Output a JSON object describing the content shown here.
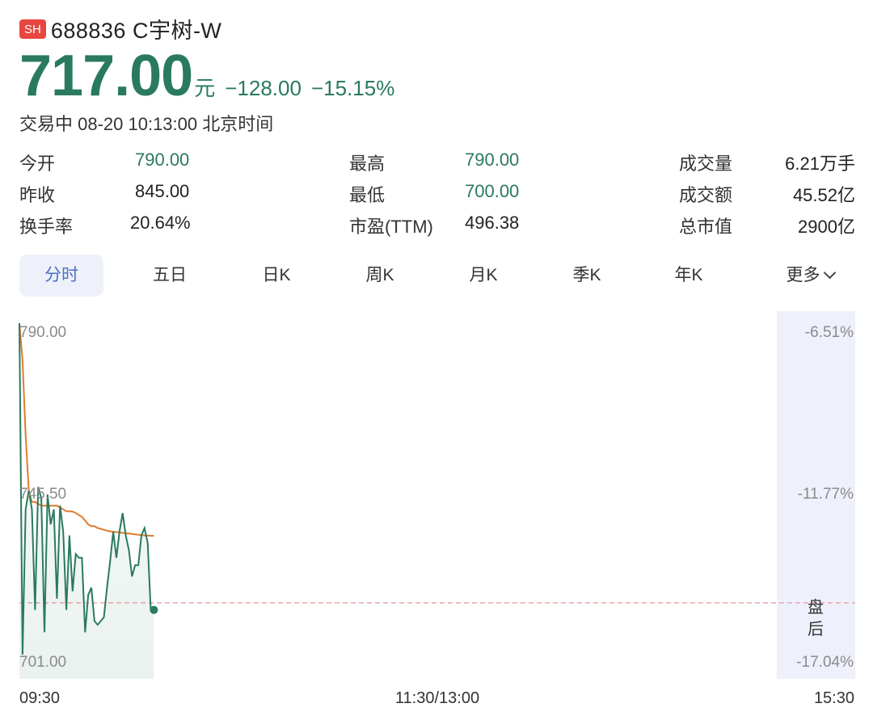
{
  "header": {
    "market_badge": "SH",
    "stock_name": "688836 C宇树-W"
  },
  "quote": {
    "price": "717.00",
    "unit": "元",
    "change": "−128.00",
    "change_pct": "−15.15%",
    "status": "交易中 08-20 10:13:00 北京时间"
  },
  "stats": {
    "open_label": "今开",
    "open_value": "790.00",
    "prev_close_label": "昨收",
    "prev_close_value": "845.00",
    "turnover_rate_label": "换手率",
    "turnover_rate_value": "20.64%",
    "high_label": "最高",
    "high_value": "790.00",
    "low_label": "最低",
    "low_value": "700.00",
    "pe_label": "市盈(TTM)",
    "pe_value": "496.38",
    "volume_label": "成交量",
    "volume_value": "6.21万手",
    "amount_label": "成交额",
    "amount_value": "45.52亿",
    "market_cap_label": "总市值",
    "market_cap_value": "2900亿"
  },
  "tabs": [
    "分时",
    "五日",
    "日K",
    "周K",
    "月K",
    "季K",
    "年K",
    "更多"
  ],
  "active_tab": 0,
  "colors": {
    "price_green": "#2a7a5e",
    "avg_line": "#e07b2e",
    "badge_red": "#e8473f",
    "ref_line": "#e89a9a",
    "after_hours_bg": "#eef0fb"
  },
  "chart_data": {
    "type": "line",
    "x_labels": [
      "09:30",
      "11:30/13:00",
      "15:30"
    ],
    "y_labels_left": [
      "790.00",
      "745.50",
      "701.00"
    ],
    "y_labels_right": [
      "-6.51%",
      "-11.77%",
      "-17.04%"
    ],
    "ylim": [
      701.0,
      790.0
    ],
    "after_hours_label": "盘后",
    "x_minutes": [
      0,
      1,
      2,
      3,
      4,
      5,
      6,
      7,
      8,
      9,
      10,
      11,
      12,
      13,
      14,
      15,
      16,
      17,
      18,
      19,
      20,
      21,
      22,
      23,
      24,
      25,
      26,
      27,
      28,
      29,
      30,
      31,
      32,
      33,
      34,
      35,
      36,
      37,
      38,
      39,
      40,
      41,
      42,
      43
    ],
    "series": [
      {
        "values": [
          790,
          701,
          740,
          745,
          740,
          713,
          746,
          743,
          707,
          744,
          736,
          740,
          716,
          741,
          734,
          713,
          733,
          718,
          728,
          727,
          727,
          707,
          717,
          719,
          710,
          709,
          710,
          711,
          719,
          726,
          734,
          727,
          734,
          739,
          733,
          729,
          722,
          725,
          725,
          733,
          735,
          731,
          713,
          713
        ]
      },
      {
        "values": [
          790,
          780,
          760,
          745,
          742,
          742,
          741.5,
          741,
          741,
          741,
          741,
          741,
          741,
          740.5,
          740,
          739.5,
          739.5,
          739.4,
          739,
          738.5,
          738,
          737,
          736,
          735.5,
          735.5,
          735,
          734.8,
          734.5,
          734.3,
          734.1,
          734,
          733.9,
          733.8,
          733.7,
          733.6,
          733.5,
          733.4,
          733.3,
          733.2,
          733.1,
          733,
          733,
          732.9,
          732.9
        ]
      }
    ]
  }
}
